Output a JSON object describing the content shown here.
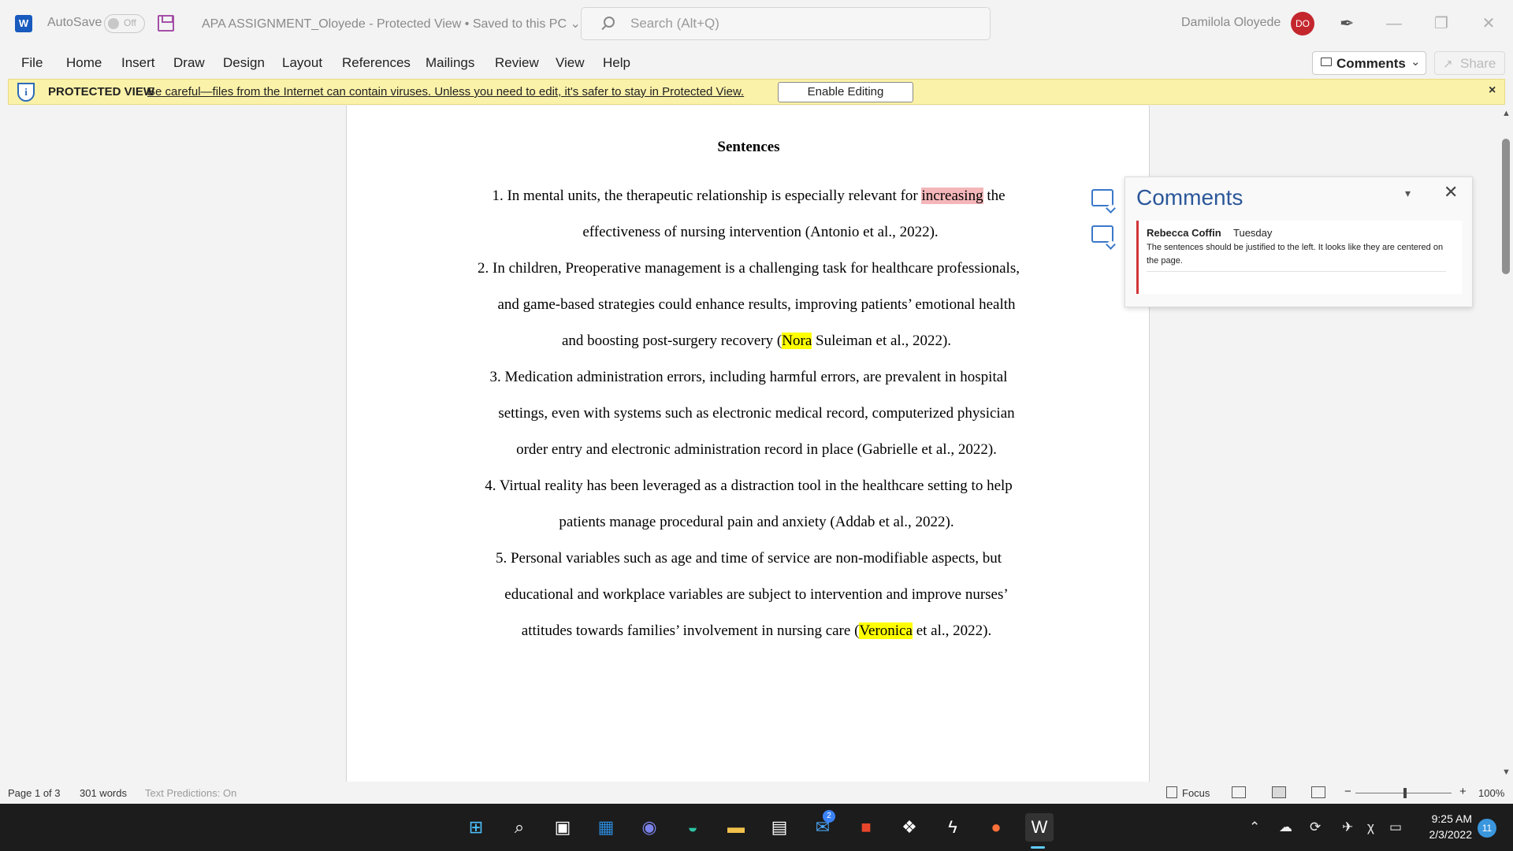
{
  "titlebar": {
    "app_logo": "W",
    "autosave_label": "AutoSave",
    "autosave_state": "Off",
    "doc_title": "APA ASSIGNMENT_Oloyede  -  Protected View • Saved to this PC  ⌄",
    "search_placeholder": "Search (Alt+Q)",
    "user_name": "Damilola  Oloyede",
    "user_initials": "DO",
    "pen_glyph": "✒",
    "minimize_glyph": "—",
    "restore_glyph": "❐",
    "close_glyph": "✕"
  },
  "ribbon": {
    "tabs": [
      "File",
      "Home",
      "Insert",
      "Draw",
      "Design",
      "Layout",
      "References",
      "Mailings",
      "Review",
      "View",
      "Help"
    ],
    "comments_label": "Comments",
    "comments_chevron": "⌄",
    "share_label": "Share",
    "share_glyph": "↗"
  },
  "protected_view": {
    "title": "PROTECTED VIEW",
    "message": "Be careful—files from the Internet can contain viruses. Unless you need to edit, it's safer to stay in Protected View.",
    "button": "Enable Editing",
    "close": "×",
    "shield_glyph": "i"
  },
  "document": {
    "heading": "Sentences",
    "item1": {
      "l1_pre": "1.   In mental units, the therapeutic relationship is especially relevant for ",
      "l1_hl": "increasing",
      "l1_post": " the",
      "l2": "effectiveness of nursing intervention (Antonio et al., 2022)."
    },
    "item2": {
      "l1": "2.   In children, Preoperative management is a challenging task for healthcare professionals,",
      "l2": "and game-based strategies could enhance results, improving patients’ emotional health",
      "l3_pre": "and boosting post-surgery recovery (",
      "l3_hl": "Nora",
      "l3_post": " Suleiman et al., 2022)."
    },
    "item3": {
      "l1": "3.   Medication administration errors, including harmful errors, are prevalent in hospital",
      "l2": "settings, even with systems such as electronic medical record, computerized physician",
      "l3": "order entry and electronic administration record in place (Gabrielle et al., 2022)."
    },
    "item4": {
      "l1": "4.   Virtual reality has been leveraged as a distraction tool in the healthcare setting to help",
      "l2": "patients manage procedural pain and anxiety (Addab et al., 2022)."
    },
    "item5": {
      "l1": "5.   Personal variables such as age and time of service are non-modifiable aspects, but",
      "l2": "educational and workplace variables are subject to intervention and improve nurses’",
      "l3_pre": "attitudes towards families’ involvement in nursing care (",
      "l3_hl": "Veronica",
      "l3_post": " et al., 2022)."
    }
  },
  "comments_pane": {
    "heading": "Comments",
    "chevron": "▾",
    "close": "✕",
    "comment": {
      "author": "Rebecca Coffin",
      "when": "Tuesday",
      "text": "The sentences should be justified to the left. It looks like they are centered on the page."
    }
  },
  "scrollbar": {
    "up": "▲",
    "down": "▼"
  },
  "statusbar": {
    "page": "Page 1 of 3",
    "words": "301 words",
    "predictions": "Text Predictions: On",
    "focus": "Focus",
    "zoom_minus": "−",
    "zoom_plus": "+",
    "zoom": "100%"
  },
  "taskbar": {
    "time": "9:25 AM",
    "date": "2/3/2022",
    "notifications": "11",
    "mail_badge": "2",
    "apps": [
      {
        "name": "start-button",
        "glyph": "⊞",
        "color": "#4cc2ff"
      },
      {
        "name": "search-button",
        "glyph": "⌕",
        "color": "#ffffff"
      },
      {
        "name": "task-view-button",
        "glyph": "▣",
        "color": "#ffffff"
      },
      {
        "name": "widgets-button",
        "glyph": "▦",
        "color": "#2b88d8"
      },
      {
        "name": "teams-chat-button",
        "glyph": "◉",
        "color": "#7b83eb"
      },
      {
        "name": "edge-browser-button",
        "glyph": "◒",
        "color": "#2bc4a4"
      },
      {
        "name": "file-explorer-button",
        "glyph": "▬",
        "color": "#f2c14b"
      },
      {
        "name": "store-button",
        "glyph": "▤",
        "color": "#ffffff"
      },
      {
        "name": "mail-button",
        "glyph": "✉",
        "color": "#4aa3f0"
      },
      {
        "name": "office-button",
        "glyph": "■",
        "color": "#e8462b"
      },
      {
        "name": "dropbox-button",
        "glyph": "❖",
        "color": "#ffffff"
      },
      {
        "name": "app-s-button",
        "glyph": "ϟ",
        "color": "#ffffff"
      },
      {
        "name": "firefox-button",
        "glyph": "●",
        "color": "#ff7139"
      },
      {
        "name": "word-taskbar-button",
        "glyph": "W",
        "color": "#ffffff"
      }
    ],
    "tray": {
      "chevron": "⌃",
      "cloud": "☁",
      "sync": "⟳",
      "airplane": "✈",
      "volume": "χ",
      "battery": "▭"
    }
  }
}
